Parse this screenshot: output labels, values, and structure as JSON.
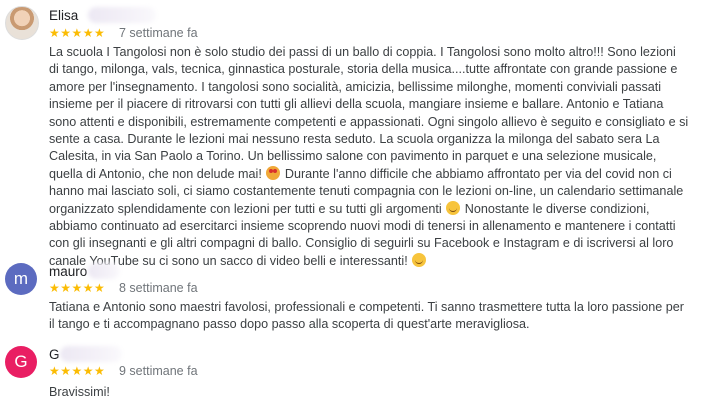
{
  "reviews": [
    {
      "name": "Elisa",
      "stars": "★★★★★",
      "when": "7 settimane fa",
      "avatar_color": "#e8d9c8",
      "text": [
        "La scuola I Tangolosi non è solo studio dei passi di un ballo di coppia. I Tangolosi sono molto altro!!! Sono lezioni di tango, milonga, vals, tecnica, ginnastica posturale, storia della musica....tutte affrontate con grande passione e amore per l'insegnamento. I tangolosi sono socialità, amicizia, bellissime milonghe, momenti conviviali passati insieme per il piacere di ritrovarsi con tutti gli allievi della scuola, mangiare insieme e ballare. Antonio e Tatiana sono attenti e disponibili, estremamente competenti e appassionati. Ogni singolo allievo è seguito e consigliato e si sente a casa. Durante le lezioni mai nessuno resta seduto. La scuola organizza la milonga del sabato sera La Calesita, in via San Paolo a Torino. Un bellissimo salone con pavimento in parquet e una selezione musicale, quella di Antonio, che non delude mai!",
        "Durante l'anno difficile che abbiamo affrontato per via del covid non ci hanno mai lasciato soli, ci siamo costantemente tenuti compagnia con le lezioni on-line, un calendario settimanale organizzato splendidamente con lezioni per tutti e su tutti gli argomenti",
        "Nonostante le diverse condizioni, abbiamo continuato ad esercitarci insieme scoprendo nuovi modi di tenersi in allenamento e mantenere i contatti con gli insegnanti e gli altri compagni di ballo. Consiglio di seguirli su Facebook e Instagram e di iscriversi al loro canale YouTube su ci sono un sacco di video belli e interessanti!"
      ]
    },
    {
      "name": "mauro",
      "avatar_letter": "m",
      "avatar_color": "#5c6bc0",
      "stars": "★★★★★",
      "when": "8 settimane fa",
      "text": "Tatiana e Antonio sono maestri favolosi, professionali e competenti. Ti sanno trasmettere tutta la loro passione per il tango e ti accompagnano passo dopo passo alla scoperta di quest'arte meravigliosa."
    },
    {
      "name": "G",
      "avatar_letter": "G",
      "avatar_color": "#e91e63",
      "stars": "★★★★★",
      "when": "9 settimane fa",
      "text": "Bravissimi!"
    }
  ]
}
